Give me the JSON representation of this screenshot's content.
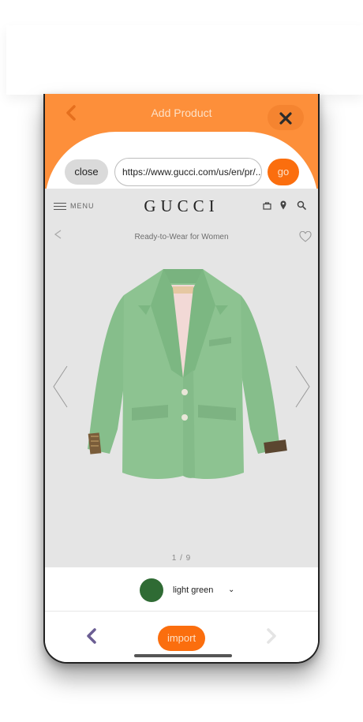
{
  "header": {
    "title": "Add Product",
    "back_icon": "chevron-left-icon",
    "close_icon": "x-icon"
  },
  "url_bar": {
    "close_label": "close",
    "url_value": "https://www.gucci.com/us/en/pr/...",
    "go_label": "go"
  },
  "site": {
    "menu_label": "MENU",
    "logo": "GUCCI",
    "category": "Ready-to-Wear for Women",
    "pager": "1 / 9",
    "label_text": "GUCCI"
  },
  "color_select": {
    "label": "light green",
    "swatch_color": "#2f6b34",
    "chevron": "⌄"
  },
  "footer": {
    "import_label": "import"
  },
  "colors": {
    "accent": "#fd8f3a",
    "button_orange": "#fb6e0e",
    "prev_arrow": "#6b5e93",
    "jacket_green": "#8dc391"
  }
}
